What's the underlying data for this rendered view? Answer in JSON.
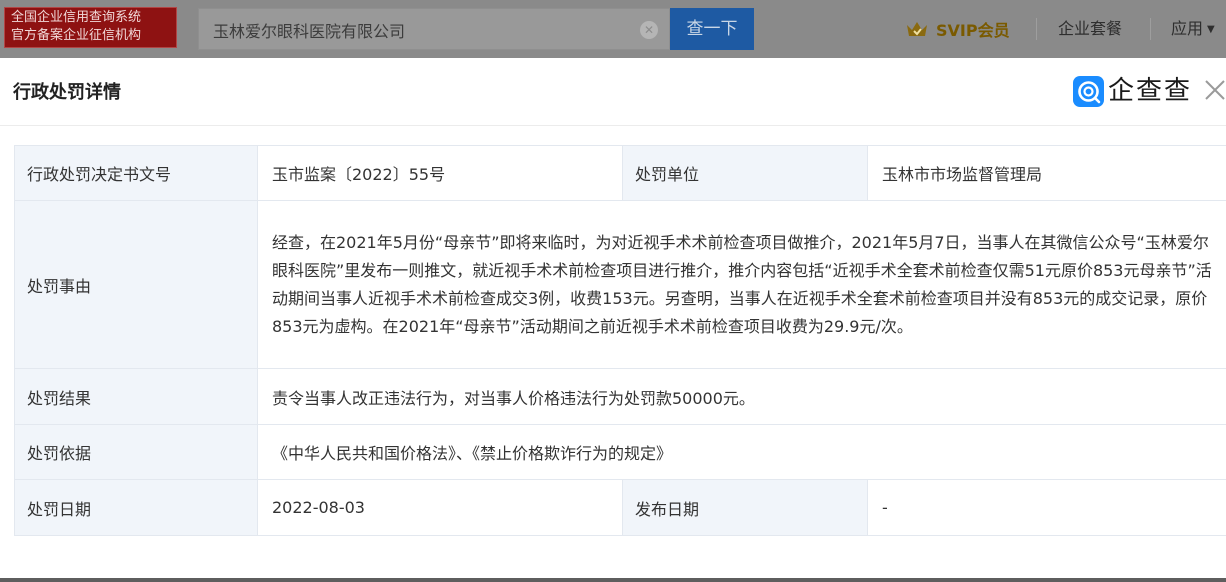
{
  "topbar": {
    "logo_lines": [
      "全国企业信用查询系统",
      "官方备案企业征信机构"
    ],
    "search_value": "玉林爱尔眼科医院有限公司",
    "search_button": "查一下",
    "svip_label": "SVIP会员",
    "nav": [
      "企业套餐",
      "应用"
    ],
    "icons": {
      "clear": "clear-circle-icon",
      "svip": "crown-icon",
      "dropdown": "caret-down-icon"
    }
  },
  "modal": {
    "title": "行政处罚详情",
    "brand": "企查查",
    "icons": {
      "brand": "qichacha-logo-icon",
      "close": "close-icon"
    },
    "rows": {
      "doc_no_label": "行政处罚决定书文号",
      "doc_no": "玉市监案〔2022〕55号",
      "unit_label": "处罚单位",
      "unit": "玉林市市场监督管理局",
      "reason_label": "处罚事由",
      "reason": "经查，在2021年5月份“母亲节”即将来临时，为对近视手术术前检查项目做推介，2021年5月7日，当事人在其微信公众号“玉林爱尔眼科医院”里发布一则推文，就近视手术术前检查项目进行推介，推介内容包括“近视手术全套术前检查仅需51元原价853元母亲节”活动期间当事人近视手术术前检查成交3例，收费153元。另查明，当事人在近视手术全套术前检查项目并没有853元的成交记录，原价853元为虚构。在2021年“母亲节”活动期间之前近视手术术前检查项目收费为29.9元/次。",
      "result_label": "处罚结果",
      "result": "责令当事人改正违法行为，对当事人价格违法行为处罚款50000元。",
      "basis_label": "处罚依据",
      "basis": "《中华人民共和国价格法》、《禁止价格欺诈行为的规定》",
      "date_label": "处罚日期",
      "date": "2022-08-03",
      "publish_label": "发布日期",
      "publish": "-"
    }
  },
  "colors": {
    "brand_blue": "#1a8cff",
    "search_button": "#1e5aa3",
    "logo_red": "#8e1212",
    "svip_gold": "#7a5a00"
  }
}
